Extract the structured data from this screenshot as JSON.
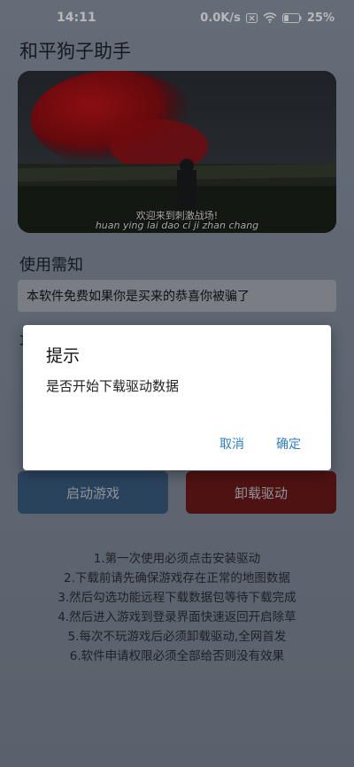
{
  "status_bar": {
    "time": "14:11",
    "speed": "0.0K/s",
    "battery": "25%",
    "icons": [
      "close-box-icon",
      "wifi-icon",
      "battery-icon"
    ]
  },
  "app": {
    "title": "和平狗子助手",
    "banner": {
      "caption_cn": "欢迎来到刺激战场!",
      "caption_pinyin": "huan ying lai dao ci ji zhan chang"
    },
    "usage_title": "使用需知",
    "notice_text": "本软件免费如果你是买来的恭喜你被骗了",
    "section2_title_partial": "功",
    "buttons": {
      "start_game": "启动游戏",
      "uninstall_driver": "卸载驱动"
    },
    "instructions": [
      "1.第一次使用必须点击安装驱动",
      "2.下载前请先确保游戏存在正常的地图数据",
      "3.然后勾选功能远程下载数据包等待下载完成",
      "4.然后进入游戏到登录界面快速返回开启除草",
      "5.每次不玩游戏后必须卸载驱动,全网首发",
      "6.软件申请权限必须全部给否则没有效果"
    ]
  },
  "dialog": {
    "title": "提示",
    "message": "是否开始下载驱动数据",
    "cancel": "取消",
    "confirm": "确定"
  },
  "colors": {
    "start_button": "#3b5d82",
    "uninstall_button": "#6e1a1a",
    "dialog_action": "#2e7dd1"
  }
}
